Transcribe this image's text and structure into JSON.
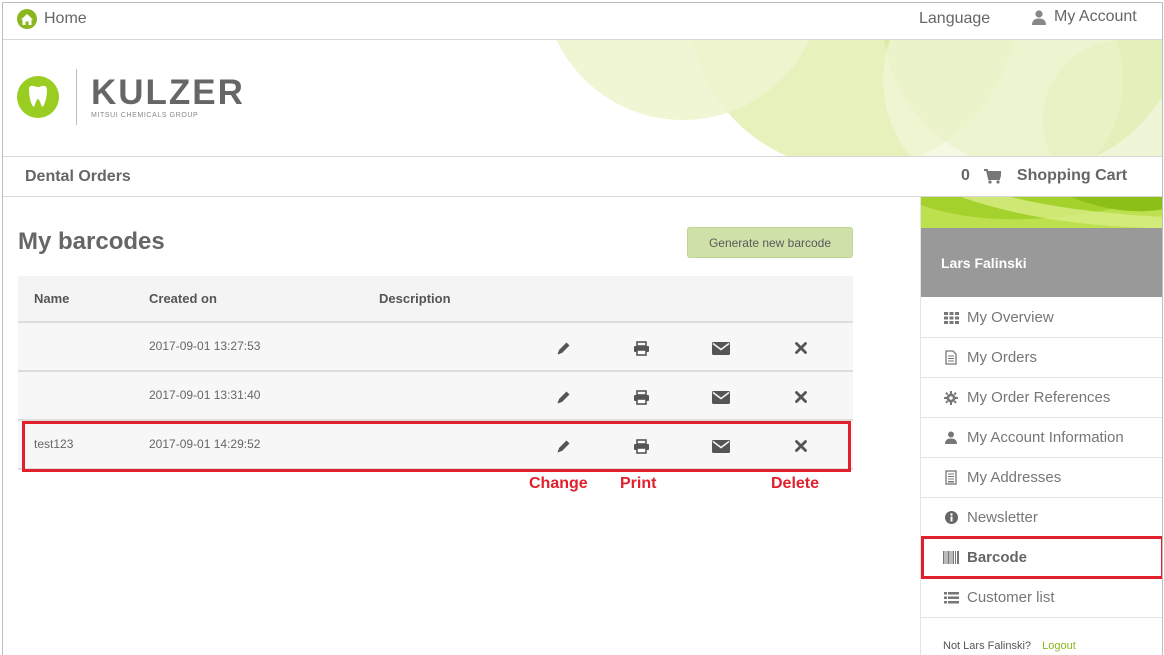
{
  "topbar": {
    "home_label": "Home",
    "language_label": "Language",
    "account_label": "My Account"
  },
  "brand": {
    "name": "KULZER",
    "tagline": "MITSUI CHEMICALS GROUP",
    "accent_color": "#8ab71e"
  },
  "navbar": {
    "section_title": "Dental Orders",
    "cart_count": "0",
    "cart_label": "Shopping Cart"
  },
  "main": {
    "title": "My barcodes",
    "generate_button": "Generate new barcode",
    "columns": [
      "Name",
      "Created on",
      "Description"
    ],
    "rows": [
      {
        "name": "",
        "created": "2017-09-01 13:27:53",
        "description": ""
      },
      {
        "name": "",
        "created": "2017-09-01 13:31:40",
        "description": ""
      },
      {
        "name": "test123",
        "created": "2017-09-01 14:29:52",
        "description": ""
      }
    ],
    "action_labels": {
      "change": "Change",
      "print": "Print",
      "delete": "Delete"
    }
  },
  "sidebar": {
    "user_name": "Lars Falinski",
    "items": [
      {
        "label": "My Overview",
        "icon": "grid-icon"
      },
      {
        "label": "My Orders",
        "icon": "document-icon"
      },
      {
        "label": "My Order References",
        "icon": "gear-icon"
      },
      {
        "label": "My Account Information",
        "icon": "user-icon"
      },
      {
        "label": "My Addresses",
        "icon": "address-book-icon"
      },
      {
        "label": "Newsletter",
        "icon": "info-icon"
      },
      {
        "label": "Barcode",
        "icon": "barcode-icon"
      },
      {
        "label": "Customer list",
        "icon": "list-icon"
      }
    ],
    "not_user_text": "Not Lars Falinski?",
    "logout_label": "Logout"
  },
  "colors": {
    "highlight": "#e0202c",
    "button_bg": "#cfe0a8",
    "sidebar_user_bg": "#999999"
  }
}
